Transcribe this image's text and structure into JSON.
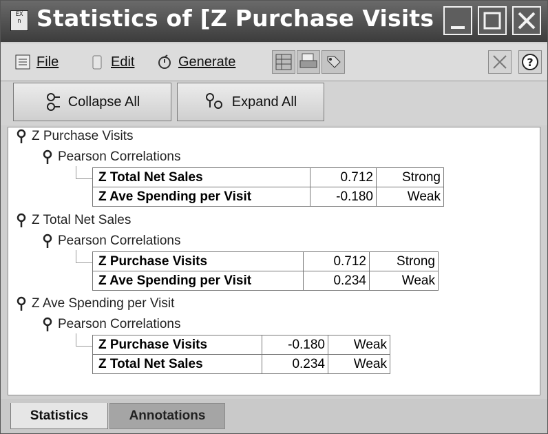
{
  "window": {
    "title": "Statistics of [Z Purchase Visits ...",
    "icon_text": "EX n"
  },
  "menu": {
    "file_label": "File",
    "edit_label": "Edit",
    "generate_label": "Generate"
  },
  "buttons": {
    "collapse_label": "Collapse All",
    "expand_label": "Expand All"
  },
  "tree": [
    {
      "field": "Z Purchase Visits",
      "group": "Pearson Correlations",
      "rows": [
        {
          "name": "Z Total Net Sales",
          "value": "0.712",
          "strength": "Strong"
        },
        {
          "name": "Z Ave Spending per Visit",
          "value": "-0.180",
          "strength": "Weak"
        }
      ]
    },
    {
      "field": "Z Total Net Sales",
      "group": "Pearson Correlations",
      "rows": [
        {
          "name": "Z Purchase Visits",
          "value": "0.712",
          "strength": "Strong"
        },
        {
          "name": "Z Ave Spending per Visit",
          "value": "0.234",
          "strength": "Weak"
        }
      ]
    },
    {
      "field": "Z Ave Spending per Visit",
      "group": "Pearson Correlations",
      "rows": [
        {
          "name": "Z Purchase Visits",
          "value": "-0.180",
          "strength": "Weak"
        },
        {
          "name": "Z Total Net Sales",
          "value": "0.234",
          "strength": "Weak"
        }
      ]
    }
  ],
  "tabs": [
    {
      "label": "Statistics",
      "active": true
    },
    {
      "label": "Annotations",
      "active": false
    }
  ]
}
